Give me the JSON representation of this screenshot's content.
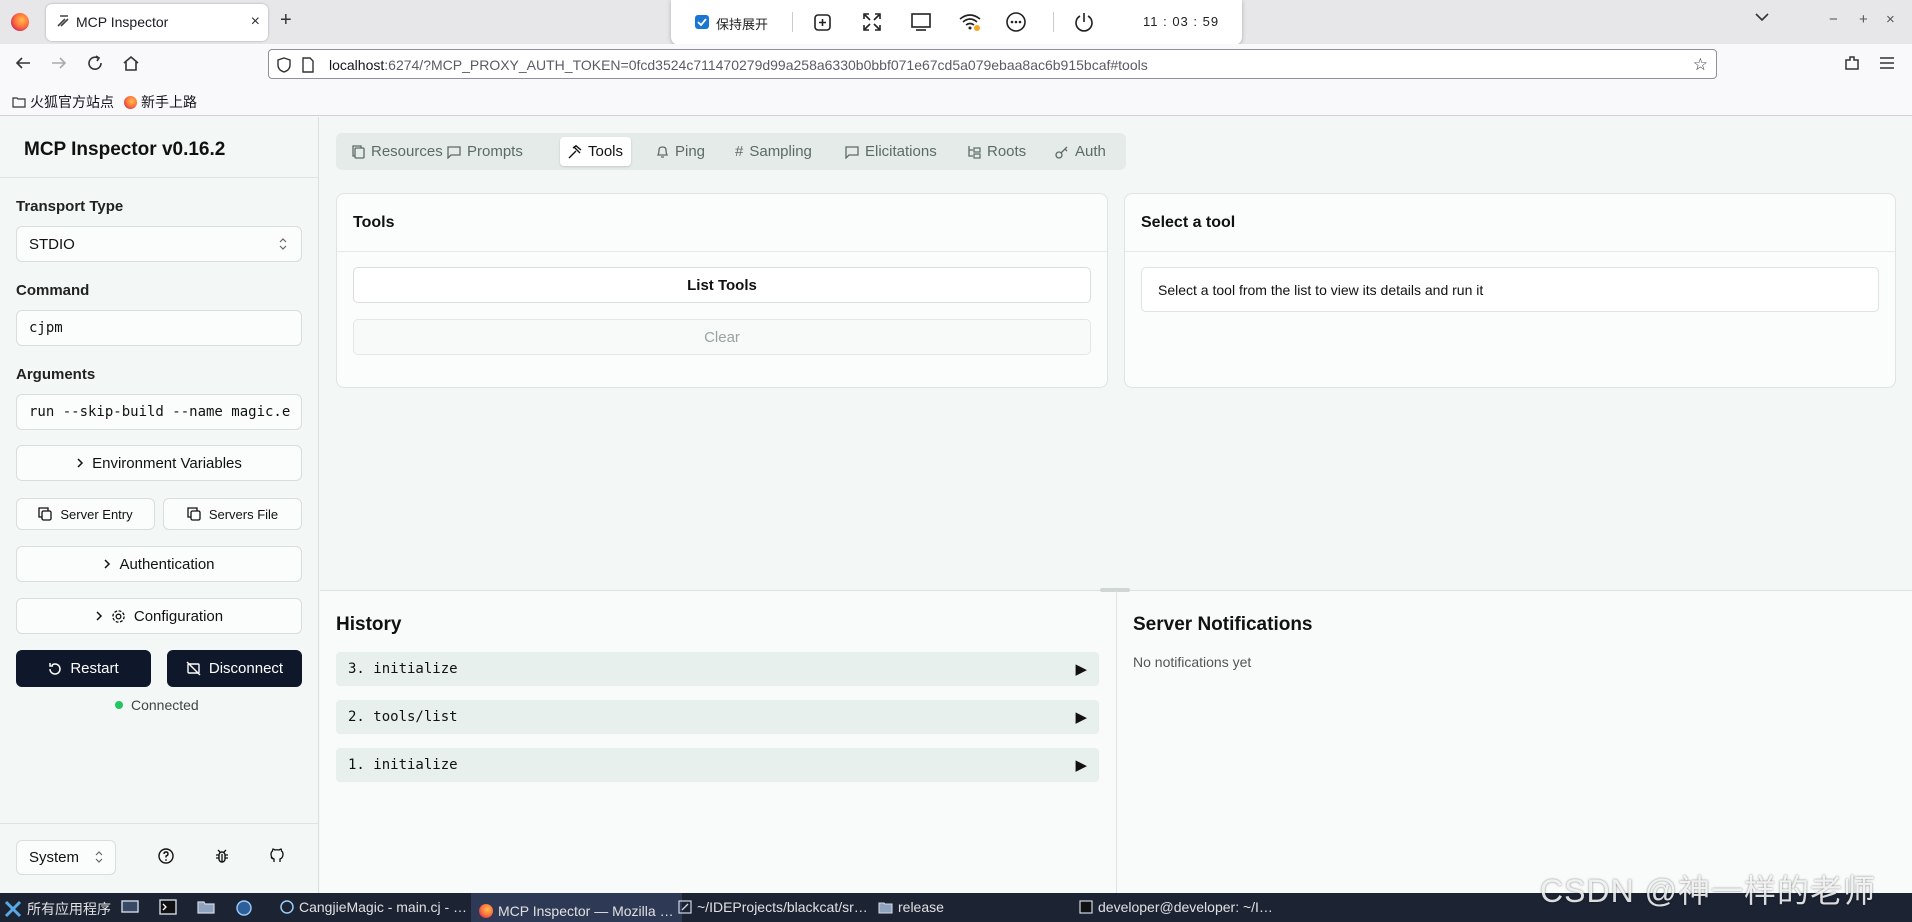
{
  "browser": {
    "tab_title": "MCP Inspector",
    "tab_close": "×",
    "new_tab": "+",
    "url_host": "localhost",
    "url_rest": ":6274/?MCP_PROXY_AUTH_TOKEN=0fcd3524c711470279d99a258a6330b0bbf071e67cd5a079ebaa8ac6b915bcaf#tools",
    "bookmarks": [
      "火狐官方站点",
      "新手上路"
    ],
    "window_controls": [
      "−",
      "+",
      "×"
    ]
  },
  "float_toolbar": {
    "keep_open_label": "保持展开",
    "keep_open_checked": true,
    "clock": "11 : 03 : 59"
  },
  "sidebar": {
    "title": "MCP Inspector v0.16.2",
    "transport_label": "Transport Type",
    "transport_value": "STDIO",
    "command_label": "Command",
    "command_value": "cjpm",
    "arguments_label": "Arguments",
    "arguments_value": "run --skip-build --name magic.e",
    "env_vars": "Environment Variables",
    "server_entry": "Server Entry",
    "servers_file": "Servers File",
    "authentication": "Authentication",
    "configuration": "Configuration",
    "restart": "Restart",
    "disconnect": "Disconnect",
    "status": "Connected",
    "theme": "System"
  },
  "main": {
    "tabs": [
      "Resources",
      "Prompts",
      "Tools",
      "Ping",
      "Sampling",
      "Elicitations",
      "Roots",
      "Auth"
    ],
    "active_tab": "Tools",
    "tools_card": {
      "title": "Tools",
      "list_button": "List Tools",
      "clear_button": "Clear"
    },
    "detail_card": {
      "title": "Select a tool",
      "message": "Select a tool from the list to view its details and run it"
    }
  },
  "history": {
    "title": "History",
    "items": [
      "3. initialize",
      "2. tools/list",
      "1. initialize"
    ]
  },
  "notifications": {
    "title": "Server Notifications",
    "empty": "No notifications yet"
  },
  "taskbar": {
    "start": "所有应用程序",
    "windows": [
      "CangjieMagic - main.cj - …",
      "MCP Inspector — Mozilla …",
      "~/IDEProjects/blackcat/sr…",
      "release",
      "developer@developer: ~/I…"
    ]
  },
  "watermark": "CSDN @神一样的老师",
  "colors": {
    "accent_dark": "#0f172a",
    "connected": "#22c55e",
    "page_bg": "#f3f8f6"
  }
}
